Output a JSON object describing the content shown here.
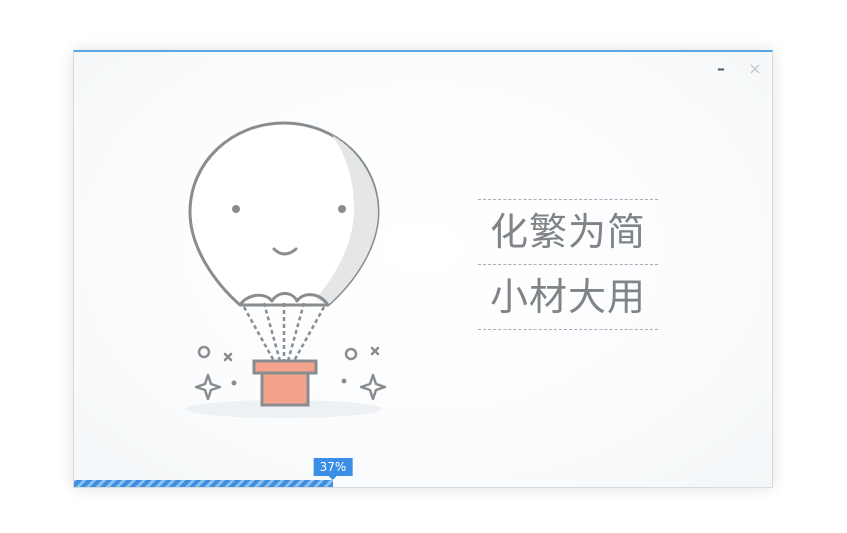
{
  "window": {
    "minimize_label": "–",
    "close_label": "×"
  },
  "illustration": {
    "name": "hot-air-balloon-illustration"
  },
  "slogan": {
    "line1": "化繁为简",
    "line2": "小材大用"
  },
  "progress": {
    "percent": 37,
    "label": "37%"
  },
  "colors": {
    "accent": "#3a8ee6",
    "basket": "#f3a38c",
    "outline": "#8a8d90",
    "text": "#808488"
  }
}
